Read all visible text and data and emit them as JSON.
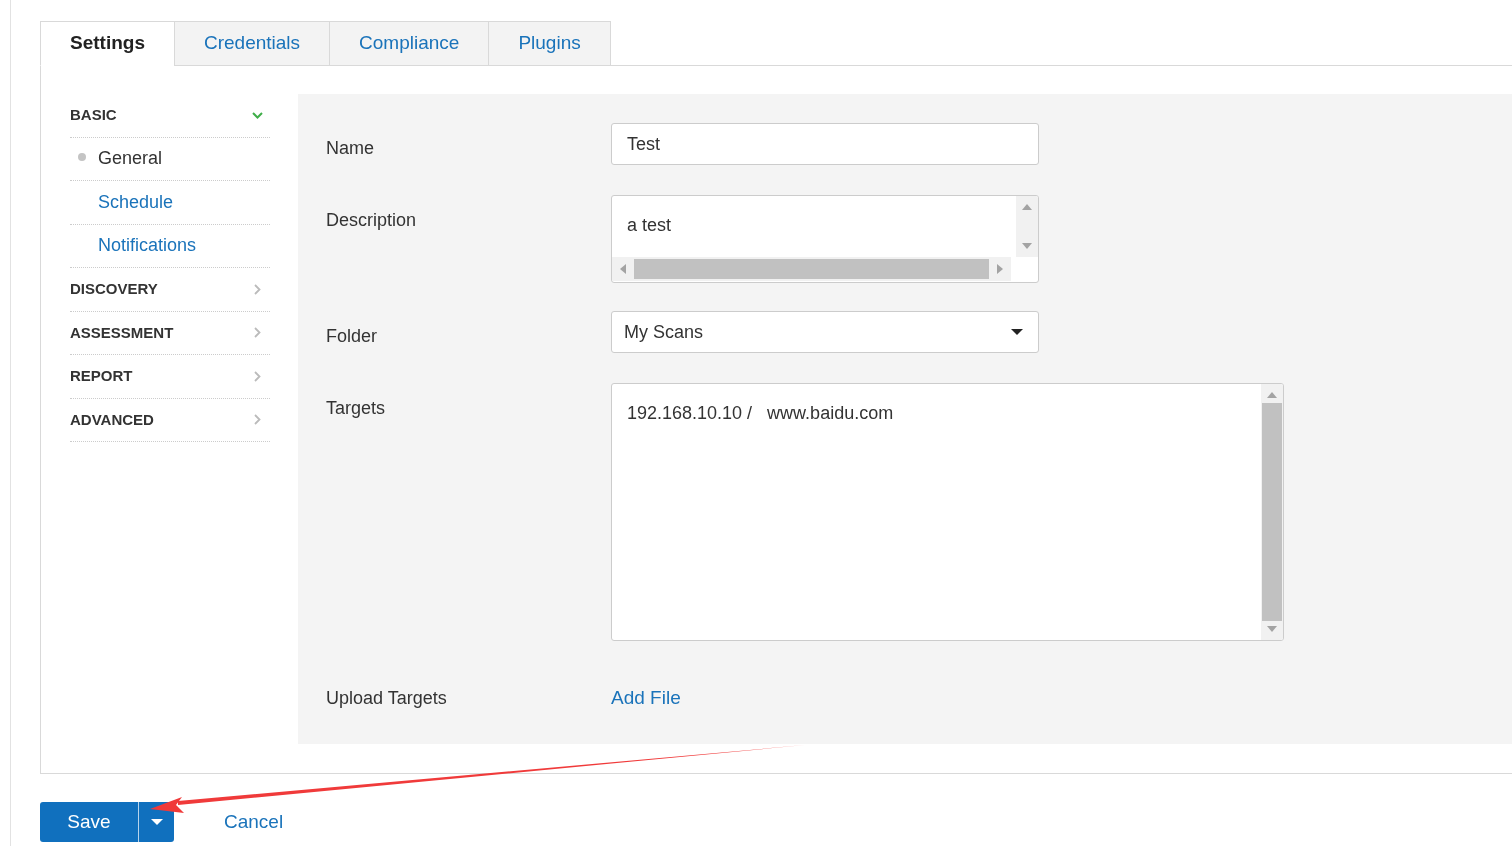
{
  "tabs": [
    {
      "label": "Settings",
      "selected": true
    },
    {
      "label": "Credentials",
      "selected": false
    },
    {
      "label": "Compliance",
      "selected": false
    },
    {
      "label": "Plugins",
      "selected": false
    }
  ],
  "sidebar": {
    "sections": [
      {
        "label": "BASIC",
        "expanded": true,
        "children": [
          {
            "label": "General",
            "selected": true
          },
          {
            "label": "Schedule",
            "selected": false
          },
          {
            "label": "Notifications",
            "selected": false
          }
        ]
      },
      {
        "label": "DISCOVERY",
        "expanded": false
      },
      {
        "label": "ASSESSMENT",
        "expanded": false
      },
      {
        "label": "REPORT",
        "expanded": false
      },
      {
        "label": "ADVANCED",
        "expanded": false
      }
    ]
  },
  "form": {
    "fields": [
      {
        "kind": "text",
        "label": "Name",
        "value": "Test"
      },
      {
        "kind": "textarea",
        "label": "Description",
        "value": "a test"
      },
      {
        "kind": "select",
        "label": "Folder",
        "value": "My Scans"
      },
      {
        "kind": "targets",
        "label": "Targets",
        "value": "192.168.10.10 /   www.baidu.com"
      },
      {
        "kind": "file",
        "label": "Upload Targets",
        "link": "Add File"
      }
    ]
  },
  "actions": {
    "save": "Save",
    "cancel": "Cancel"
  }
}
